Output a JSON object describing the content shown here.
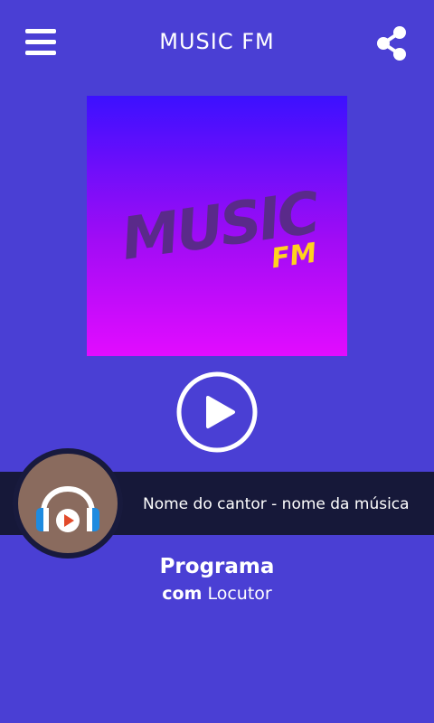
{
  "header": {
    "title": "MUSIC FM"
  },
  "cover": {
    "logo_main": "MUSIC",
    "logo_sub": "FM"
  },
  "now_playing": {
    "text": "Nome do cantor - nome da música"
  },
  "program": {
    "name": "Programa",
    "host_prefix": "com",
    "host_name": "Locutor"
  },
  "icons": {
    "menu": "hamburger-menu-icon",
    "share": "share-icon",
    "play": "play-icon",
    "headphones": "headphones-icon"
  },
  "colors": {
    "background": "#4a3fd4",
    "nowbar": "#161839",
    "accent_yellow": "#ffd21f"
  }
}
